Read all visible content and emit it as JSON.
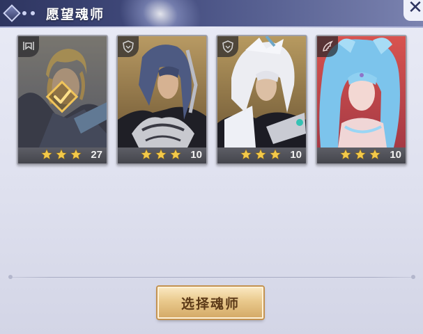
{
  "header": {
    "title": "愿望魂师",
    "close_glyph": "✕"
  },
  "cards": [
    {
      "level": "27",
      "stars": 3,
      "faction_icon": "banner-icon",
      "selected": true
    },
    {
      "level": "10",
      "stars": 3,
      "faction_icon": "shield-icon",
      "selected": false
    },
    {
      "level": "10",
      "stars": 3,
      "faction_icon": "shield-icon",
      "selected": false
    },
    {
      "level": "10",
      "stars": 3,
      "faction_icon": "wing-icon",
      "selected": false
    }
  ],
  "footer": {
    "select_label": "选择魂师"
  },
  "colors": {
    "header": "#414a7c",
    "star": "#f3c94a",
    "button": "#e9c98c"
  }
}
